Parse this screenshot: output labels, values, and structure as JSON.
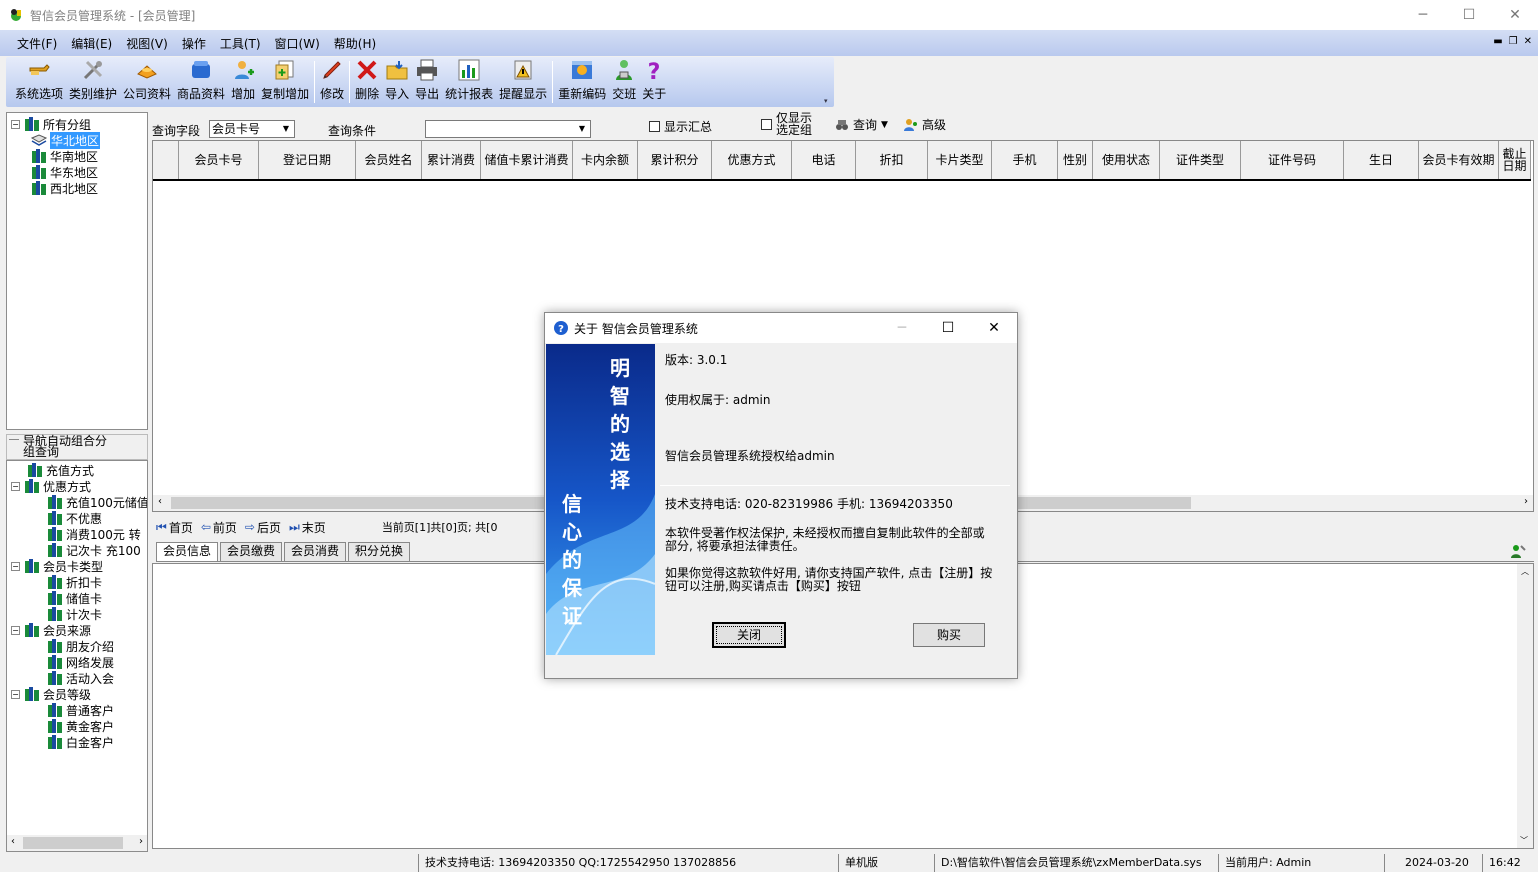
{
  "window": {
    "title": "智信会员管理系统 - [会员管理]"
  },
  "menu": [
    "文件(F)",
    "编辑(E)",
    "视图(V)",
    "操作",
    "工具(T)",
    "窗口(W)",
    "帮助(H)"
  ],
  "toolbar": {
    "items": [
      "系统选项",
      "类别维护",
      "公司资料",
      "商品资料",
      "增加",
      "复制增加",
      "修改",
      "删除",
      "导入",
      "导出",
      "统计报表",
      "提醒显示",
      "重新编码",
      "交班",
      "关于"
    ]
  },
  "tree_top": {
    "root": "所有分组",
    "children": [
      "华北地区",
      "华南地区",
      "华东地区",
      "西北地区"
    ]
  },
  "nav_header": {
    "line1": "导航自动组合分",
    "line2": "组查询"
  },
  "tree_bottom": {
    "groups": [
      {
        "label": "充值方式",
        "children": []
      },
      {
        "label": "优惠方式",
        "children": [
          "充值100元储值",
          "不优惠",
          "消费100元 转",
          "记次卡 充100"
        ]
      },
      {
        "label": "会员卡类型",
        "children": [
          "折扣卡",
          "储值卡",
          "计次卡"
        ]
      },
      {
        "label": "会员来源",
        "children": [
          "朋友介绍",
          "网络发展",
          "活动入会"
        ]
      },
      {
        "label": "会员等级",
        "children": [
          "普通客户",
          "黄金客户",
          "白金客户"
        ]
      }
    ]
  },
  "query": {
    "field_label": "查询字段",
    "field_value": "会员卡号",
    "cond_label": "查询条件",
    "cond_value": "",
    "show_summary": "显示汇总",
    "only_selected_l1": "仅显示",
    "only_selected_l2": "选定组",
    "search_btn": "查询",
    "advanced_btn": "高级"
  },
  "grid": {
    "columns": [
      "会员卡号",
      "登记日期",
      "会员姓名",
      "累计消费",
      "储值卡累计消费",
      "卡内余额",
      "累计积分",
      "优惠方式",
      "电话",
      "折扣",
      "卡片类型",
      "手机",
      "性别",
      "使用状态",
      "证件类型",
      "证件号码",
      "生日",
      "会员卡有效期"
    ],
    "last_col_l1": "截止",
    "last_col_l2": "日期"
  },
  "pager": {
    "first": "首页",
    "prev": "前页",
    "next": "后页",
    "last": "末页",
    "info": "当前页[1]共[0]页; 共[0"
  },
  "tabs": [
    "会员信息",
    "会员缴费",
    "会员消费",
    "积分兑换"
  ],
  "status": {
    "support": "技术支持电话: 13694203350 QQ:1725542950 137028856",
    "edition": "单机版",
    "path": "D:\\智信软件\\智信会员管理系统\\zxMemberData.sys",
    "user": "当前用户: Admin",
    "date": "2024-03-20",
    "time": "16:42"
  },
  "about_dialog": {
    "title": "关于 智信会员管理系统",
    "banner_top": "明智的选择",
    "banner_bottom": "信心的保证",
    "version": "版本: 3.0.1",
    "licensee": "使用权属于: admin",
    "license_text": "智信会员管理系统授权给admin",
    "support": "技术支持电话: 020-82319986 手机: 13694203350",
    "copyright_l1": "本软件受著作权法保护, 未经授权而擅自复制此软件的全部或",
    "copyright_l2": "部分, 将要承担法律责任。",
    "register_l1": "如果你觉得这款软件好用, 请你支持国产软件, 点击【注册】按",
    "register_l2": "钮可以注册,购买请点击【购买】按钮",
    "close_btn": "关闭",
    "buy_btn": "购买"
  },
  "colors": {
    "menubar": "#c4d2f2",
    "banner": "#1a5ed8",
    "selection": "#3399ff"
  }
}
